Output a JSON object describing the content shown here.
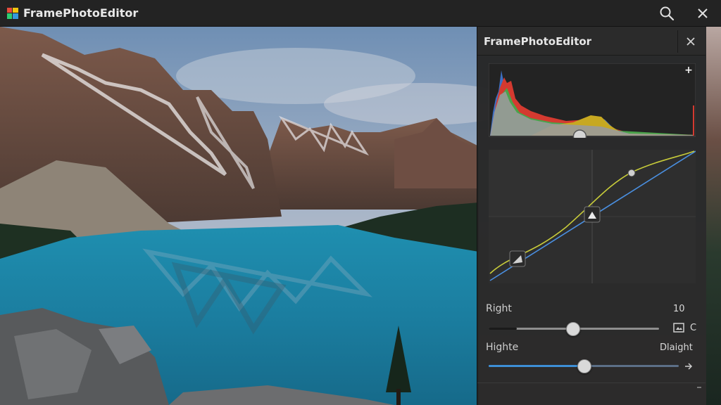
{
  "app": {
    "title": "FramePhotoEditor"
  },
  "panel": {
    "title": "FramePhotoEditor",
    "histogram": {
      "add_symbol": "+",
      "position": 0.44
    },
    "controls": [
      {
        "label": "Right",
        "value": "10",
        "level": 0.49,
        "suffix": "C"
      },
      {
        "label": "Highte",
        "value": "Dlaight",
        "level": 0.5
      }
    ]
  },
  "icons": {
    "search": "search-icon",
    "close": "close-icon",
    "logo": "app-logo-icon",
    "image_box": "image-icon",
    "arrow": "arrow-right-icon"
  },
  "colors": {
    "accent": "#3d8fd6",
    "curve_luma": "#c8cc3a",
    "curve_rgb": "#4a8fe0"
  }
}
